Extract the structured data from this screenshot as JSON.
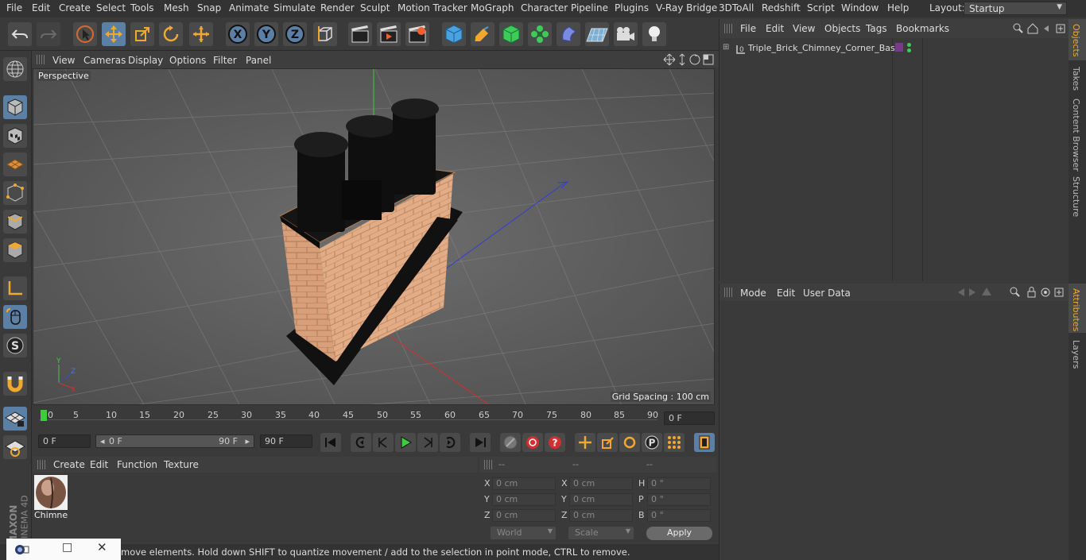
{
  "menubar": {
    "items": [
      "File",
      "Edit",
      "Create",
      "Select",
      "Tools",
      "Mesh",
      "Snap",
      "Animate",
      "Simulate",
      "Render",
      "Sculpt",
      "Motion Tracker",
      "MoGraph",
      "Character",
      "Pipeline",
      "Plugins",
      "V-Ray Bridge",
      "3DToAll",
      "Redshift",
      "Script",
      "Window",
      "Help"
    ],
    "layout_label": "Layout:",
    "layout_value": "Startup"
  },
  "viewport": {
    "menu": [
      "View",
      "Cameras",
      "Display",
      "Options",
      "Filter",
      "Panel"
    ],
    "label": "Perspective",
    "grid_spacing": "Grid Spacing : 100 cm"
  },
  "timeline": {
    "ticks": [
      "0",
      "5",
      "10",
      "15",
      "20",
      "25",
      "30",
      "35",
      "40",
      "45",
      "50",
      "55",
      "60",
      "65",
      "70",
      "75",
      "80",
      "85",
      "90"
    ],
    "current_frame": "0 F"
  },
  "controls": {
    "start_field": "0 F",
    "range_start": "0 F",
    "range_end": "90 F",
    "end_field": "90 F"
  },
  "material": {
    "menu": [
      "Create",
      "Edit",
      "Function",
      "Texture"
    ],
    "name": "Chimney"
  },
  "coords": {
    "headers": [
      "--",
      "--",
      "--"
    ],
    "rows": [
      {
        "l1": "X",
        "v1": "0 cm",
        "l2": "X",
        "v2": "0 cm",
        "l3": "H",
        "v3": "0 °"
      },
      {
        "l1": "Y",
        "v1": "0 cm",
        "l2": "Y",
        "v2": "0 cm",
        "l3": "P",
        "v3": "0 °"
      },
      {
        "l1": "Z",
        "v1": "0 cm",
        "l2": "Z",
        "v2": "0 cm",
        "l3": "B",
        "v3": "0 °"
      }
    ],
    "world": "World",
    "scale": "Scale",
    "apply": "Apply"
  },
  "status": {
    "text": "move elements. Hold down SHIFT to quantize movement / add to the selection in point mode, CTRL to remove."
  },
  "objects": {
    "menu": [
      "File",
      "Edit",
      "View",
      "Objects",
      "Tags",
      "Bookmarks"
    ],
    "item_name": "Triple_Brick_Chimney_Corner_Base"
  },
  "attributes": {
    "menu": [
      "Mode",
      "Edit",
      "User Data"
    ]
  },
  "sidetabs": [
    "Objects",
    "Takes",
    "Content Browser",
    "Structure",
    "Attributes",
    "Layers"
  ],
  "branding": {
    "maxon": "MAXON",
    "cinema": "CINEMA 4D"
  },
  "colors": {
    "accent": "#5c7fa6",
    "orange": "#f0a830",
    "play_green": "#3ecb3e",
    "record_red": "#d03030"
  }
}
